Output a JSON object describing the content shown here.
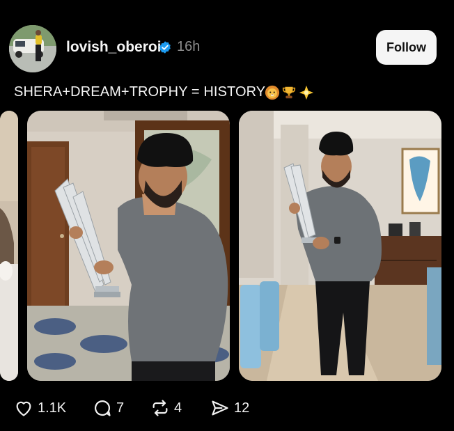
{
  "post": {
    "username": "lovish_oberoi",
    "time": "16h",
    "follow_label": "Follow",
    "caption": "SHERA+DREAM+TROPHY = HISTORY",
    "caption_emojis": [
      "lion-face-emoji",
      "trophy-emoji",
      "sparkle-star-emoji"
    ]
  },
  "actions": {
    "likes": "1.1K",
    "comments": "7",
    "reposts": "4",
    "shares": "12"
  },
  "colors": {
    "background": "#000000",
    "text": "#f3f3f3",
    "muted": "#8e8e8e",
    "verified": "#1d9bf0",
    "button_bg": "#f5f5f5"
  }
}
